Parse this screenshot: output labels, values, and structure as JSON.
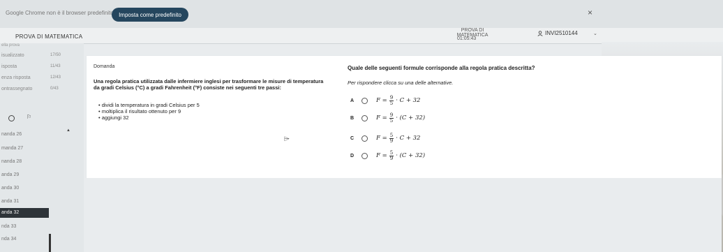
{
  "notification": {
    "text": "Google Chrome non è il browser predefinito",
    "button_label": "Imposta come predefinito",
    "close_glyph": "×"
  },
  "header": {
    "exam_title": "PROVA DI MATEMATICA",
    "center_title": "PROVA DI MATEMATICA",
    "timer": "01:05:43",
    "user_id": "INVI2510144",
    "user_icon": "user-icon",
    "chevron": "⌄"
  },
  "sidebar": {
    "title": "ella prova",
    "stats": [
      {
        "label": "isualizzato",
        "count": "17/50"
      },
      {
        "label": "isposta",
        "count": "11/43"
      },
      {
        "label": "enza risposta",
        "count": "12/43"
      },
      {
        "label": "ontrassegnato",
        "count": "0/43"
      }
    ],
    "flag_glyph": "⚐",
    "triangle_glyph": "▲",
    "nav_items": [
      "nanda 26",
      "manda 27",
      "nanda 28",
      "anda 29",
      "anda 30",
      "anda 31",
      "anda 32",
      "nda 33",
      "nda 34"
    ],
    "active_index": 6
  },
  "question": {
    "domanda_label": "Domanda",
    "text_line1": "Una regola pratica utilizzata dalle infermiere inglesi per trasformare le misure di temperatura",
    "text_line2": "da gradi Celsius (°C) a gradi Fahrenheit (°F) consiste nei seguenti tre passi:",
    "steps": [
      "dividi la temperatura in gradi Celsius per 5",
      "moltiplica il risultato ottenuto per 9",
      "aggiungi 32"
    ],
    "prompt": "Quale delle seguenti formule corrisponde alla regola pratica descritta?",
    "instruction": "Per rispondere clicca su una delle alternative.",
    "options": [
      {
        "letter": "A",
        "lhs": "F =",
        "num": "9",
        "den": "5",
        "rhs": "· C + 32"
      },
      {
        "letter": "B",
        "lhs": "F =",
        "num": "9",
        "den": "5",
        "rhs": "· (C + 32)"
      },
      {
        "letter": "C",
        "lhs": "F =",
        "num": "5",
        "den": "9",
        "rhs": "· C + 32"
      },
      {
        "letter": "D",
        "lhs": "F =",
        "num": "5",
        "den": "9",
        "rhs": "· (C + 32)"
      }
    ]
  },
  "colors": {
    "accent": "#25465e",
    "active_nav": "#2e3439"
  }
}
